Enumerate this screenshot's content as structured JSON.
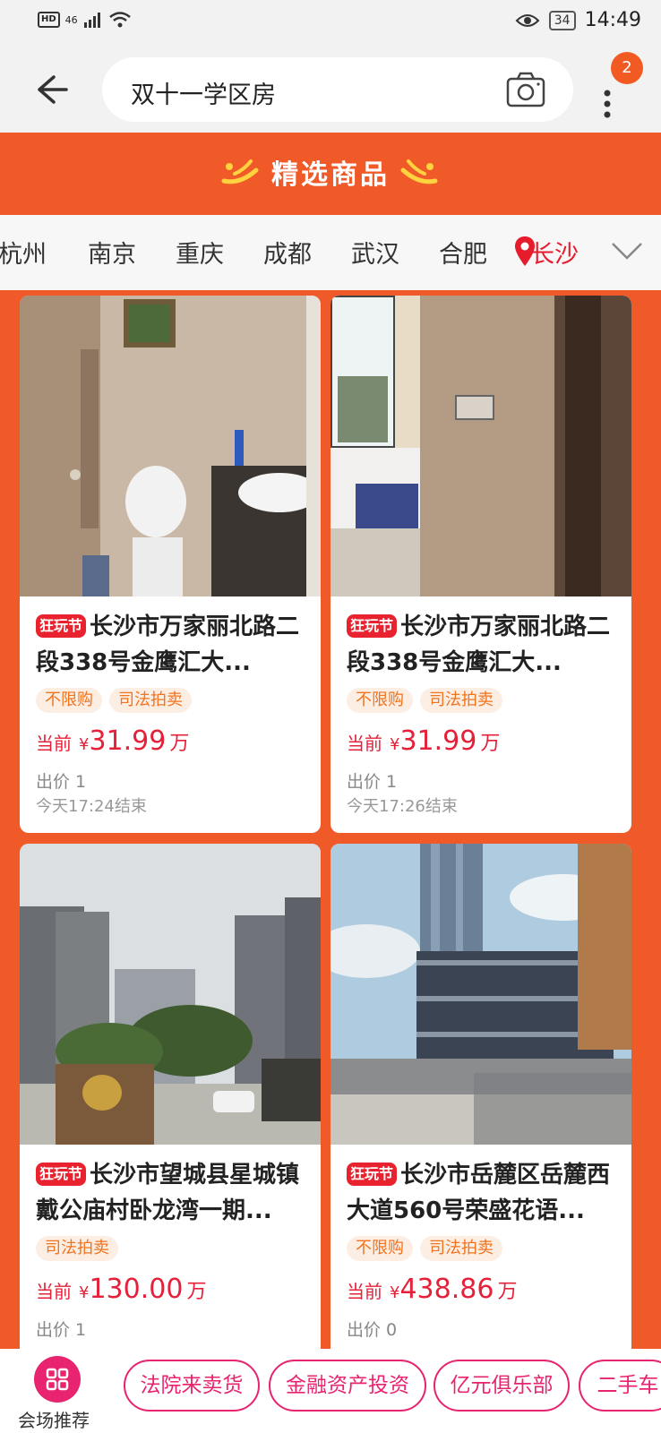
{
  "status_bar": {
    "time": "14:49",
    "battery": "34",
    "hd": "HD",
    "network": "46"
  },
  "search": {
    "query": "双十一学区房",
    "notification_count": "2"
  },
  "banner": {
    "title": "精选商品"
  },
  "cities": [
    "杭州",
    "南京",
    "重庆",
    "成都",
    "武汉",
    "合肥",
    "长沙"
  ],
  "active_city": "长沙",
  "listings": [
    {
      "badge": "狂玩节",
      "title": "长沙市万家丽北路二段338号金鹰汇大...",
      "tags": [
        "不限购",
        "司法拍卖"
      ],
      "price_label": "当前",
      "currency": "¥",
      "price": "31.99",
      "unit": "万",
      "bids": "出价 1",
      "end_time": "今天17:24结束"
    },
    {
      "badge": "狂玩节",
      "title": "长沙市万家丽北路二段338号金鹰汇大...",
      "tags": [
        "不限购",
        "司法拍卖"
      ],
      "price_label": "当前",
      "currency": "¥",
      "price": "31.99",
      "unit": "万",
      "bids": "出价 1",
      "end_time": "今天17:26结束"
    },
    {
      "badge": "狂玩节",
      "title": "长沙市望城县星城镇戴公庙村卧龙湾一期...",
      "tags": [
        "司法拍卖"
      ],
      "price_label": "当前",
      "currency": "¥",
      "price": "130.00",
      "unit": "万",
      "bids": "出价 1",
      "end_time": ""
    },
    {
      "badge": "狂玩节",
      "title": "长沙市岳麓区岳麓西大道560号荣盛花语...",
      "tags": [
        "不限购",
        "司法拍卖"
      ],
      "price_label": "当前",
      "currency": "¥",
      "price": "438.86",
      "unit": "万",
      "bids": "出价 0",
      "end_time": ""
    }
  ],
  "bottom_bar": {
    "venue_label": "会场推荐",
    "pills": [
      "法院来卖货",
      "金融资产投资",
      "亿元俱乐部",
      "二手车"
    ]
  },
  "colors": {
    "brand_orange": "#f05a28",
    "price_red": "#e5213a",
    "tag_orange": "#f0731e",
    "pink": "#e8236f"
  }
}
